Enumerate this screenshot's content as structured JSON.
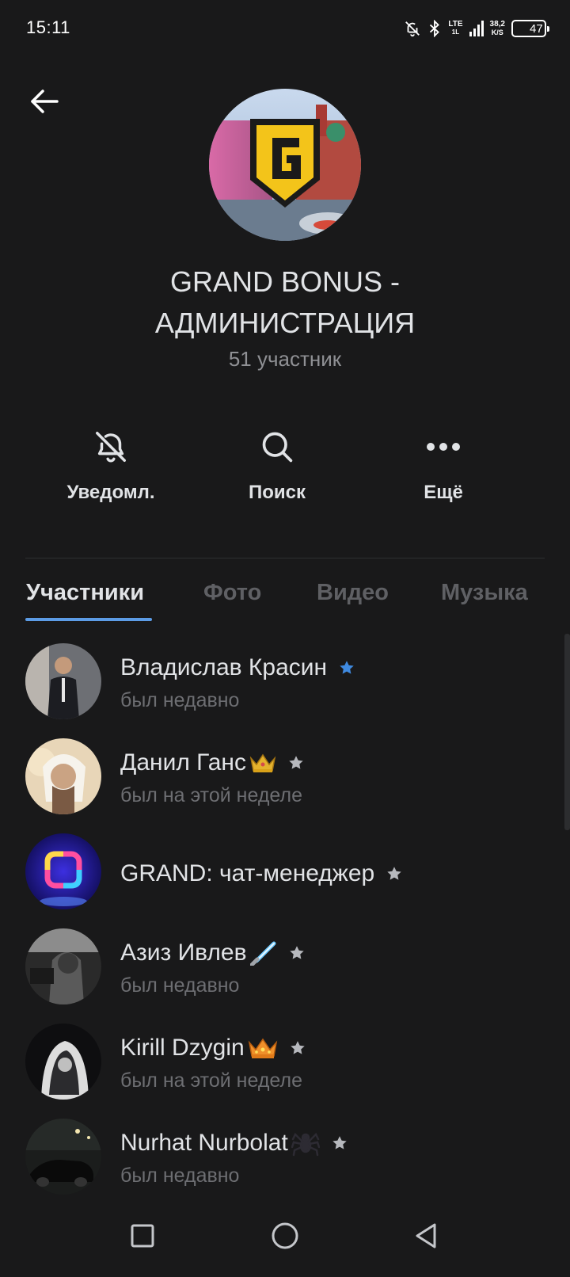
{
  "status_bar": {
    "time": "15:11",
    "network_type": "LTE",
    "network_sub": "1L",
    "net_speed_value": "38,2",
    "net_speed_unit": "K/S",
    "battery_level": "47"
  },
  "header": {
    "title_line1": "GRAND BONUS -",
    "title_line2": "АДМИНИСТРАЦИЯ",
    "members_count": "51 участник",
    "avatar_icon": "grand-logo-g"
  },
  "actions": [
    {
      "label": "Уведомл.",
      "icon": "bell-off-icon"
    },
    {
      "label": "Поиск",
      "icon": "search-icon"
    },
    {
      "label": "Ещё",
      "icon": "more-dots-icon"
    }
  ],
  "tabs": [
    {
      "label": "Участники",
      "active": true
    },
    {
      "label": "Фото",
      "active": false
    },
    {
      "label": "Видео",
      "active": false
    },
    {
      "label": "Музыка",
      "active": false
    }
  ],
  "members": [
    {
      "name": "Владислав Красин",
      "status": "был недавно",
      "emoji": "",
      "star_color": "#3f8ae0"
    },
    {
      "name": "Данил Ганс",
      "status": "был на этой неделе",
      "emoji": "crown-icon",
      "star_color": "#b6b8bd"
    },
    {
      "name": "GRAND: чат-менеджер",
      "status": "",
      "emoji": "",
      "star_color": "#b6b8bd"
    },
    {
      "name": "Азиз Ивлев",
      "status": "был недавно",
      "emoji": "lightsaber-icon",
      "star_color": "#b6b8bd"
    },
    {
      "name": "Kirill Dzygin",
      "status": "был на этой неделе",
      "emoji": "crown-icon",
      "star_color": "#b6b8bd"
    },
    {
      "name": "Nurhat Nurbolat",
      "status": "был недавно",
      "emoji": "spider-icon",
      "star_color": "#b6b8bd"
    }
  ],
  "colors": {
    "background": "#19191a",
    "accent": "#5c9ce6",
    "text_primary": "#e1e3e6",
    "text_secondary": "#6d6e72"
  }
}
